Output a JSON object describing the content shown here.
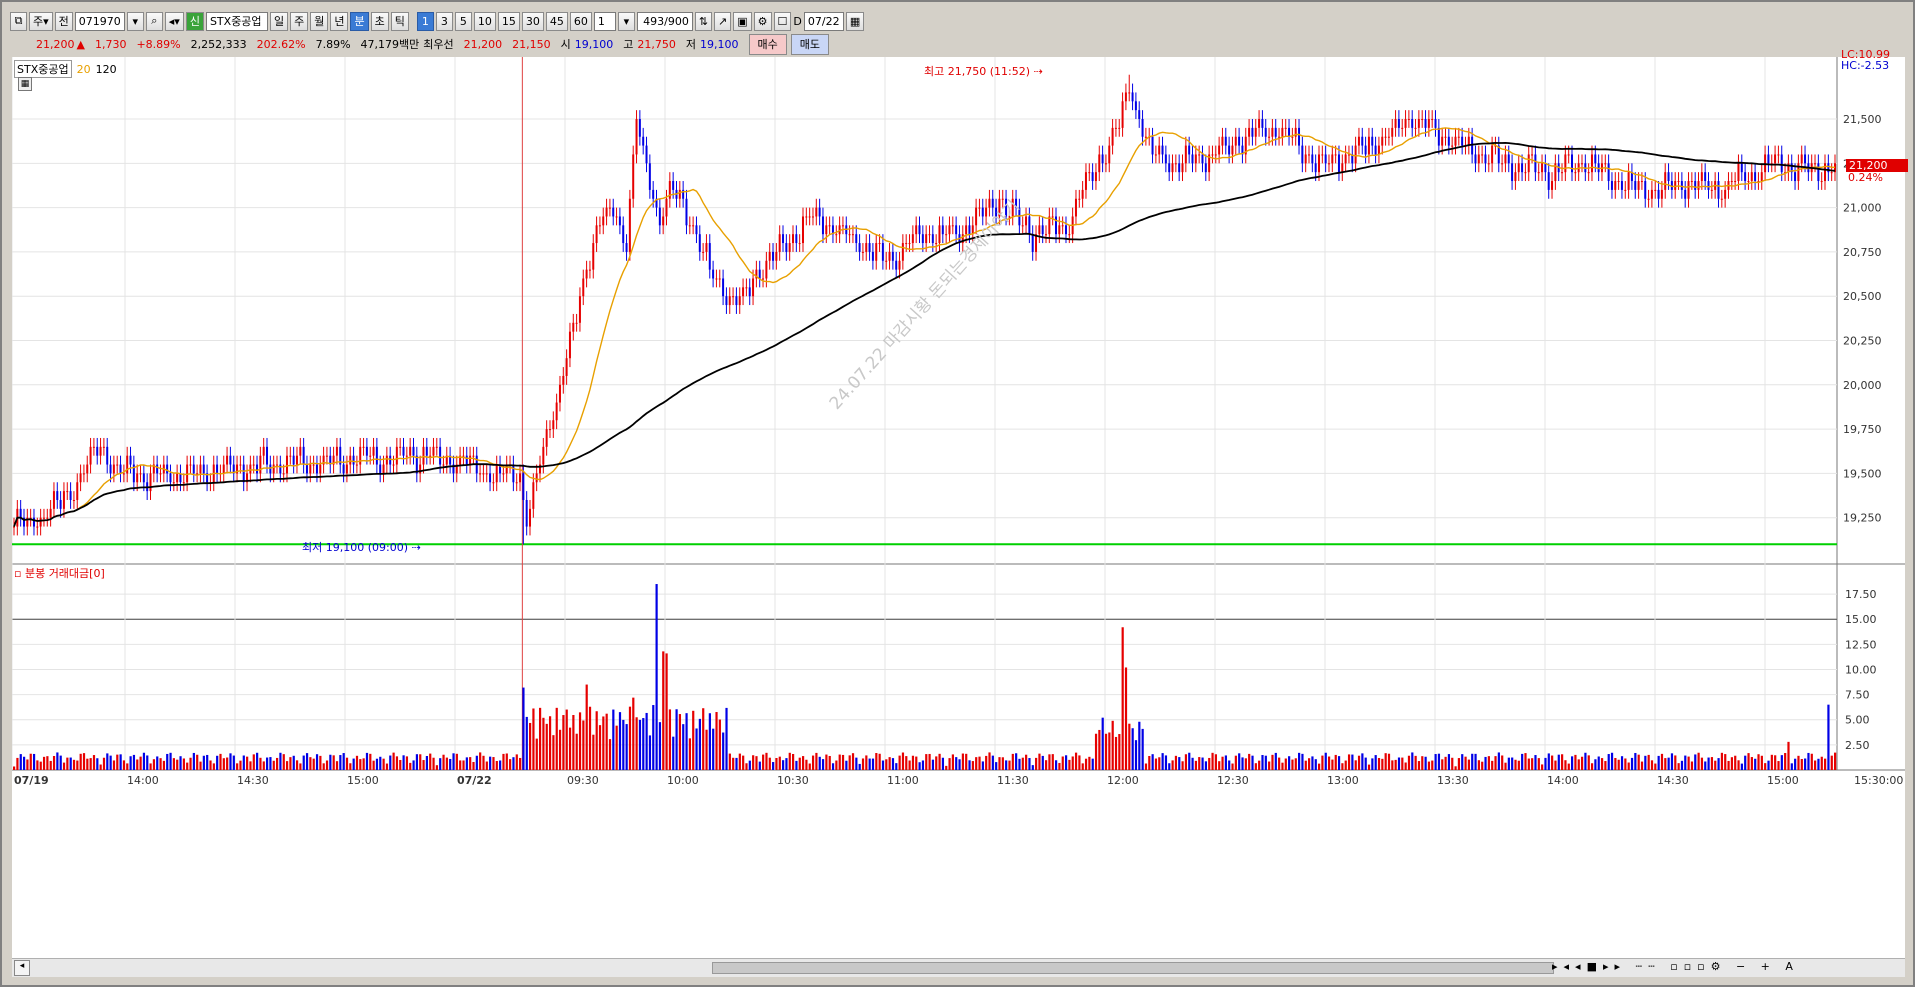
{
  "toolbar": {
    "code": "071970",
    "stock_name": "STX중공업",
    "prefix_label": "주",
    "all_label": "전",
    "badge": "신",
    "period_buttons": [
      "일",
      "주",
      "월",
      "년",
      "분",
      "초",
      "틱"
    ],
    "interval_buttons": [
      "1",
      "3",
      "5",
      "10",
      "15",
      "30",
      "45",
      "60"
    ],
    "interval_value": "1",
    "count": "493/900",
    "date": "07/22",
    "d_label": "D"
  },
  "info": {
    "price": "21,200",
    "arrow": "▲",
    "change": "1,730",
    "change_pct": "+8.89%",
    "volume": "2,252,333",
    "volume_ratio": "202.62%",
    "turnover": "7.89%",
    "amount": "47,179백만",
    "best_label": "최우선",
    "ask": "21,200",
    "bid": "21,150",
    "open_label": "시",
    "open": "19,100",
    "high_label": "고",
    "high": "21,750",
    "low_label": "저",
    "low": "19,100",
    "buy": "매수",
    "sell": "매도"
  },
  "legend": {
    "name": "STX중공업",
    "ma1": "20",
    "ma2": "120"
  },
  "volume_title": "분봉 거래대금[0]",
  "annotations": {
    "high": "최고 21,750 (11:52)",
    "low": "최저 19,100 (09:00)",
    "lc": "LC:10.99",
    "hc": "HC:-2.53",
    "current_price": "21,200",
    "current_pct": "0.24%",
    "watermark": "24.07.22 마감시황  돈되는경제이야기"
  },
  "colors": {
    "up": "#e60000",
    "down": "#0000e6",
    "ma20": "#e8a000",
    "ma120": "#000000",
    "low_line": "#00d000"
  },
  "chart_data": {
    "type": "candlestick",
    "price_axis": {
      "ylim": [
        19000,
        21850
      ],
      "ticks": [
        "21,500",
        "21,250",
        "21,000",
        "20,750",
        "20,500",
        "20,250",
        "20,000",
        "19,750",
        "19,500",
        "19,250"
      ]
    },
    "volume_axis": {
      "ticks": [
        "17.50",
        "15.00",
        "12.50",
        "10.00",
        "7.50",
        "5.00",
        "2.50"
      ]
    },
    "x_ticks": [
      "07/19",
      "14:00",
      "14:30",
      "15:00",
      "07/22",
      "09:30",
      "10:00",
      "10:30",
      "11:00",
      "11:30",
      "12:00",
      "12:30",
      "13:00",
      "13:30",
      "14:00",
      "14:30",
      "15:00",
      "15:30:00"
    ],
    "price_path": [
      [
        0,
        19210
      ],
      [
        6,
        19230
      ],
      [
        12,
        19300
      ],
      [
        18,
        19420
      ],
      [
        22,
        19560
      ],
      [
        26,
        19640
      ],
      [
        30,
        19520
      ],
      [
        40,
        19480
      ],
      [
        52,
        19500
      ],
      [
        64,
        19520
      ],
      [
        80,
        19560
      ],
      [
        100,
        19580
      ],
      [
        120,
        19600
      ],
      [
        136,
        19570
      ],
      [
        144,
        19490
      ],
      [
        152,
        19500
      ],
      [
        153,
        19150
      ],
      [
        156,
        19400
      ],
      [
        160,
        19700
      ],
      [
        164,
        20000
      ],
      [
        168,
        20300
      ],
      [
        172,
        20700
      ],
      [
        176,
        20900
      ],
      [
        180,
        21000
      ],
      [
        184,
        20800
      ],
      [
        187,
        21500
      ],
      [
        190,
        21200
      ],
      [
        194,
        20950
      ],
      [
        198,
        21100
      ],
      [
        204,
        20900
      ],
      [
        210,
        20600
      ],
      [
        218,
        20450
      ],
      [
        224,
        20650
      ],
      [
        232,
        20800
      ],
      [
        240,
        20950
      ],
      [
        250,
        20850
      ],
      [
        262,
        20700
      ],
      [
        272,
        20850
      ],
      [
        284,
        20850
      ],
      [
        296,
        21050
      ],
      [
        306,
        20850
      ],
      [
        316,
        20900
      ],
      [
        324,
        21200
      ],
      [
        332,
        21450
      ],
      [
        335,
        21700
      ],
      [
        338,
        21500
      ],
      [
        342,
        21300
      ],
      [
        350,
        21250
      ],
      [
        360,
        21300
      ],
      [
        370,
        21400
      ],
      [
        380,
        21450
      ],
      [
        392,
        21250
      ],
      [
        402,
        21300
      ],
      [
        412,
        21400
      ],
      [
        420,
        21500
      ],
      [
        430,
        21400
      ],
      [
        440,
        21300
      ],
      [
        450,
        21250
      ],
      [
        462,
        21200
      ],
      [
        472,
        21250
      ],
      [
        482,
        21150
      ],
      [
        492,
        21100
      ],
      [
        502,
        21150
      ],
      [
        512,
        21100
      ],
      [
        522,
        21200
      ],
      [
        532,
        21250
      ],
      [
        540,
        21200
      ],
      [
        547,
        21230
      ]
    ],
    "high_point": {
      "time": "11:52",
      "value": 21750
    },
    "low_point": {
      "time": "09:00",
      "value": 19100
    },
    "volume_spikes": [
      [
        153,
        8.2
      ],
      [
        172,
        8.5
      ],
      [
        186,
        7.2
      ],
      [
        193,
        18.5
      ],
      [
        196,
        11.6
      ],
      [
        195,
        11.8
      ],
      [
        333,
        14.2
      ],
      [
        334,
        10.2
      ],
      [
        545,
        6.5
      ],
      [
        533,
        2.8
      ]
    ],
    "hline_volume": 15.0,
    "hline_price": 19100
  }
}
